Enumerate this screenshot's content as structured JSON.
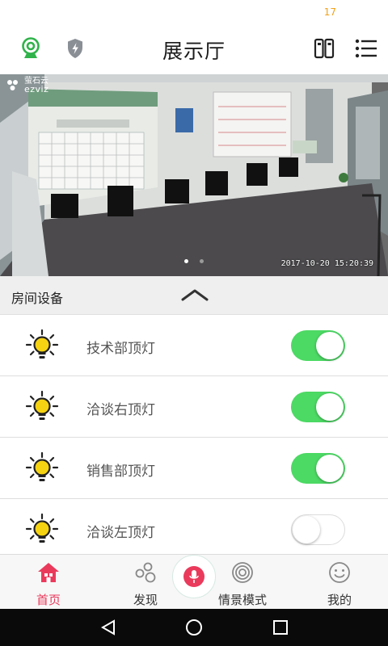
{
  "status_bar": {
    "time": "17"
  },
  "header": {
    "title": "展示厅"
  },
  "camera": {
    "logo_brand_cn": "萤石云",
    "logo_brand_en": "ezviz",
    "timestamp": "2017-10-20 15:20:39",
    "page_dots": {
      "count": 2,
      "active": 1
    }
  },
  "section": {
    "label": "房间设备"
  },
  "devices": [
    {
      "name": "技术部顶灯",
      "on": true
    },
    {
      "name": "洽谈右顶灯",
      "on": true
    },
    {
      "name": "销售部顶灯",
      "on": true
    },
    {
      "name": "洽谈左顶灯",
      "on": false
    }
  ],
  "tabs": [
    {
      "label": "首页",
      "icon": "home-icon",
      "active": true
    },
    {
      "label": "发现",
      "icon": "discover-icon",
      "active": false
    },
    {
      "label": "情景模式",
      "icon": "scene-icon",
      "active": false
    },
    {
      "label": "我的",
      "icon": "profile-icon",
      "active": false
    }
  ],
  "colors": {
    "accent": "#ea3a5c",
    "toggle_on": "#4cd964",
    "bulb": "#f5d312",
    "camera_icon": "#2fb34a",
    "status_time": "#f0a21a"
  }
}
